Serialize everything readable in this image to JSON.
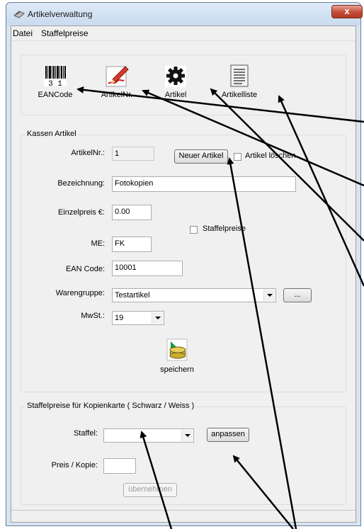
{
  "window": {
    "title": "Artikelverwaltung",
    "close_glyph": "x"
  },
  "menu": {
    "items": [
      "Datei",
      "Staffelpreise"
    ]
  },
  "toolbar": {
    "buttons": [
      {
        "label": "EANCode",
        "icon": "barcode-icon",
        "barcode_digits": "3 1"
      },
      {
        "label": "ArtikelNr.",
        "icon": "pencil-icon"
      },
      {
        "label": "Artikel",
        "icon": "gear-icon"
      },
      {
        "label": "Artikelliste",
        "icon": "list-document-icon"
      }
    ]
  },
  "kassen": {
    "legend": "Kassen Artikel",
    "artikelnr_label": "ArtikelNr.:",
    "artikelnr_value": "1",
    "neuer_artikel_button": "Neuer Artikel",
    "loeschen_checkbox": "Artikel löschen",
    "bezeichnung_label": "Bezeichnung:",
    "bezeichnung_value": "Fotokopien",
    "einzelpreis_label": "Einzelpreis €:",
    "einzelpreis_value": "0.00",
    "staffelpreise_checkbox": "Staffelpreise",
    "me_label": "ME:",
    "me_value": "FK",
    "ean_label": "EAN Code:",
    "ean_value": "10001",
    "warengruppe_label": "Warengruppe:",
    "warengruppe_value": "Testartikel",
    "browse_button": "...",
    "mwst_label": "MwSt.:",
    "mwst_value": "19",
    "speichern_label": "speichern"
  },
  "staffel": {
    "legend": "Staffelpreise für Kopienkarte ( Schwarz / Weiss )",
    "staffel_label": "Staffel:",
    "staffel_value": "",
    "anpassen_button": "anpassen",
    "preis_label": "Preis / Kopie:",
    "preis_value": "",
    "uebernehmen_button": "übernehmen"
  },
  "colors": {
    "accent_close": "#c44a36",
    "arrow": "#000000",
    "frame": "#d7e4f2"
  }
}
